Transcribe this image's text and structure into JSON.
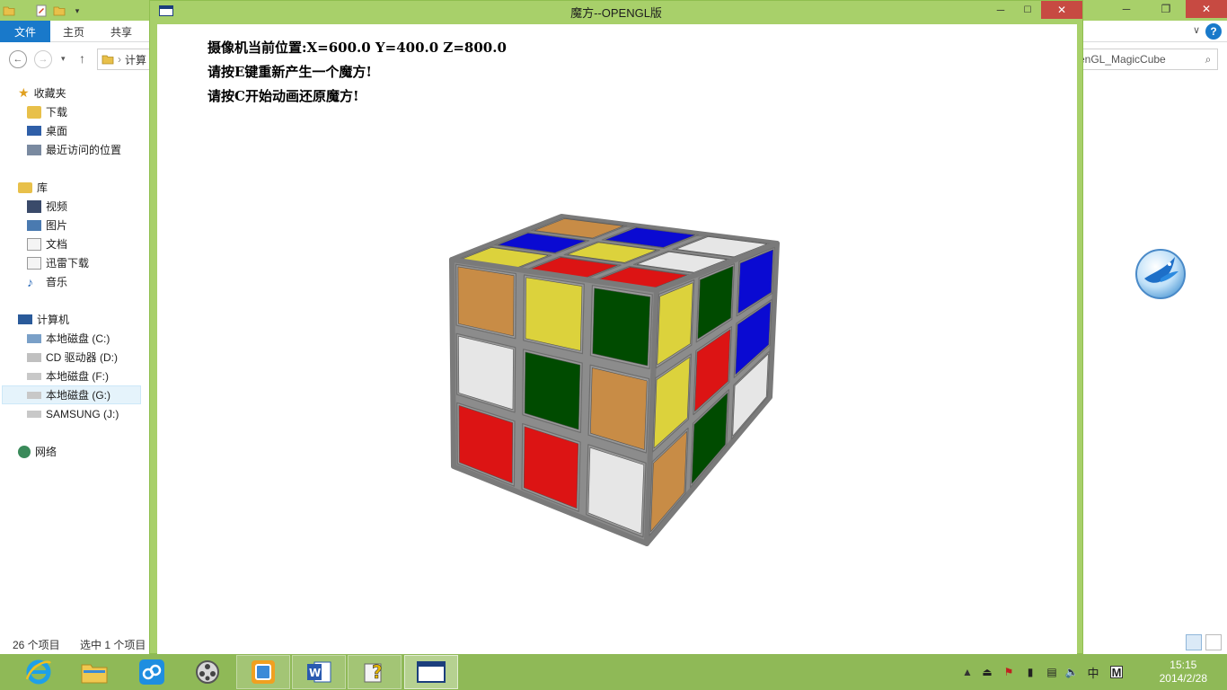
{
  "explorer": {
    "ribbon_tabs": [
      "文件",
      "主页",
      "共享"
    ],
    "address_text": "计算",
    "search_text": "enGL_MagicCube",
    "nav": {
      "favorites": {
        "label": "收藏夹",
        "items": [
          "下载",
          "桌面",
          "最近访问的位置"
        ]
      },
      "libraries": {
        "label": "库",
        "items": [
          "视频",
          "图片",
          "文档",
          "迅雷下载",
          "音乐"
        ]
      },
      "computer": {
        "label": "计算机",
        "items": [
          "本地磁盘 (C:)",
          "CD 驱动器 (D:)",
          "本地磁盘 (F:)",
          "本地磁盘 (G:)",
          "SAMSUNG (J:)"
        ]
      },
      "network": {
        "label": "网络"
      }
    },
    "status": {
      "count": "26 个项目",
      "selected": "选中 1 个项目"
    }
  },
  "gl_window": {
    "title": "魔方--OPENGL版",
    "info": {
      "camera": "摄像机当前位置:X=600.0  Y=400.0  Z=800.0",
      "line_regen": "请按E键重新产生一个魔方!",
      "line_anim": "请按C开始动画还原魔方!"
    }
  },
  "cube": {
    "colors": {
      "R": "#dc1414",
      "B": "#0a0ad2",
      "G": "#004b00",
      "Y": "#dcd23c",
      "O": "#c88c46",
      "W": "#e6e6e6",
      "frame": "#8c8c8c"
    },
    "faces": {
      "top": [
        [
          "Y",
          "B",
          "O"
        ],
        [
          "R",
          "Y",
          "B"
        ],
        [
          "R",
          "W",
          "W"
        ]
      ],
      "left": [
        [
          "O",
          "Y",
          "G"
        ],
        [
          "W",
          "G",
          "O"
        ],
        [
          "R",
          "R",
          "W"
        ]
      ],
      "right": [
        [
          "Y",
          "G",
          "B"
        ],
        [
          "Y",
          "R",
          "B"
        ],
        [
          "O",
          "G",
          "W"
        ]
      ]
    }
  },
  "taskbar": {
    "items": [
      "internet-explorer",
      "file-explorer",
      "cloud-sync",
      "media-player",
      "window-manager",
      "word",
      "help",
      "opengl-app"
    ],
    "ime": "中",
    "ime_mode": "M",
    "clock": {
      "time": "15:15",
      "date": "2014/2/28"
    }
  }
}
